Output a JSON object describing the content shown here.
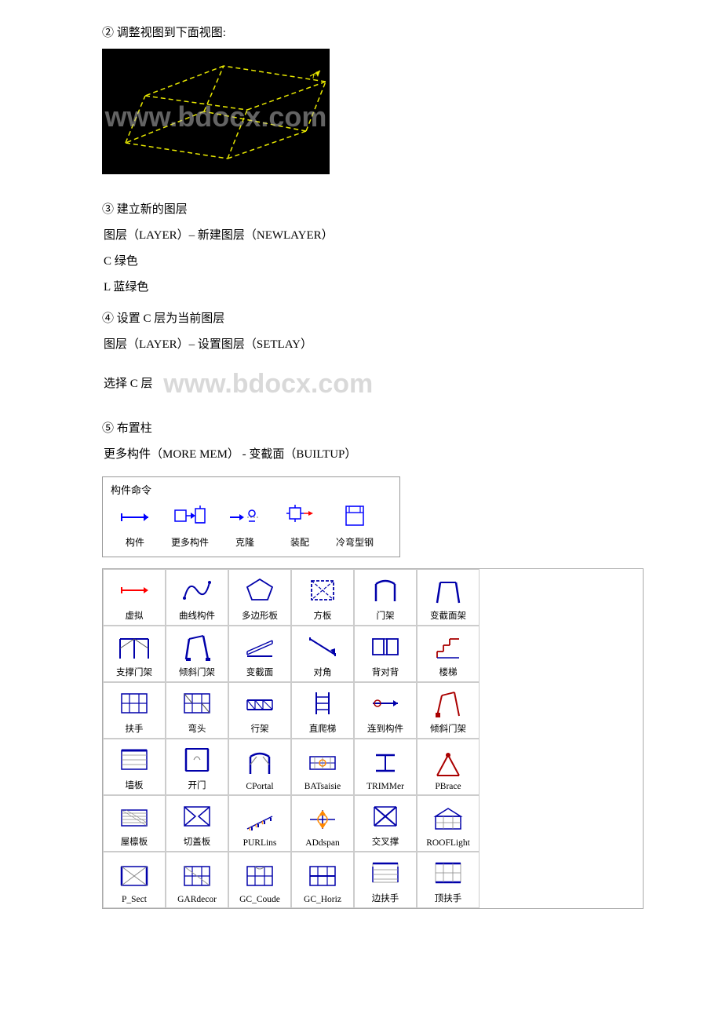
{
  "steps": [
    {
      "id": "step2",
      "heading": "② 调整视图到下面视图:",
      "subs": []
    },
    {
      "id": "step3",
      "heading": "③ 建立新的图层",
      "subs": [
        "图层（LAYER）– 新建图层（NEWLAYER）",
        "C 绿色",
        "L 蓝绿色"
      ]
    },
    {
      "id": "step4",
      "heading": "④ 设置 C 层为当前图层",
      "subs": [
        "图层（LAYER）– 设置图层（SETLAY）",
        "选择 C 层"
      ]
    },
    {
      "id": "step5",
      "heading": "⑤ 布置柱",
      "subs": [
        "更多构件（MORE MEM） - 变截面（BUILTUP）"
      ]
    }
  ],
  "panel": {
    "title": "构件命令",
    "items": [
      {
        "label": "构件"
      },
      {
        "label": "更多构件"
      },
      {
        "label": "克隆"
      },
      {
        "label": "装配"
      },
      {
        "label": "冷弯型钢"
      }
    ]
  },
  "grid_rows": [
    [
      {
        "label": "虚拟"
      },
      {
        "label": "曲线构件"
      },
      {
        "label": "多边形板"
      },
      {
        "label": "方板"
      },
      {
        "label": "门架"
      },
      {
        "label": "变截面架"
      }
    ],
    [
      {
        "label": "支撑门架"
      },
      {
        "label": "倾斜门架"
      },
      {
        "label": "变截面"
      },
      {
        "label": "对角"
      },
      {
        "label": "背对背"
      },
      {
        "label": "楼梯"
      }
    ],
    [
      {
        "label": "扶手"
      },
      {
        "label": "弯头"
      },
      {
        "label": "行架"
      },
      {
        "label": "直爬梯"
      },
      {
        "label": "连到构件"
      },
      {
        "label": "倾斜门架"
      }
    ],
    [
      {
        "label": "墙板"
      },
      {
        "label": "开门"
      },
      {
        "label": "CPortal"
      },
      {
        "label": "BATsaisie"
      },
      {
        "label": "TRIMMer"
      },
      {
        "label": "PBrace"
      }
    ],
    [
      {
        "label": "屋檩板"
      },
      {
        "label": "切盖板"
      },
      {
        "label": "PURLins"
      },
      {
        "label": "ADdspan"
      },
      {
        "label": "交叉撑"
      },
      {
        "label": "ROOFLight"
      }
    ],
    [
      {
        "label": "P_Sect"
      },
      {
        "label": "GARdecor"
      },
      {
        "label": "GC_Coude"
      },
      {
        "label": "GC_Horiz"
      },
      {
        "label": "边扶手"
      },
      {
        "label": "顶扶手"
      }
    ]
  ],
  "watermark": "www.bdocx.com"
}
